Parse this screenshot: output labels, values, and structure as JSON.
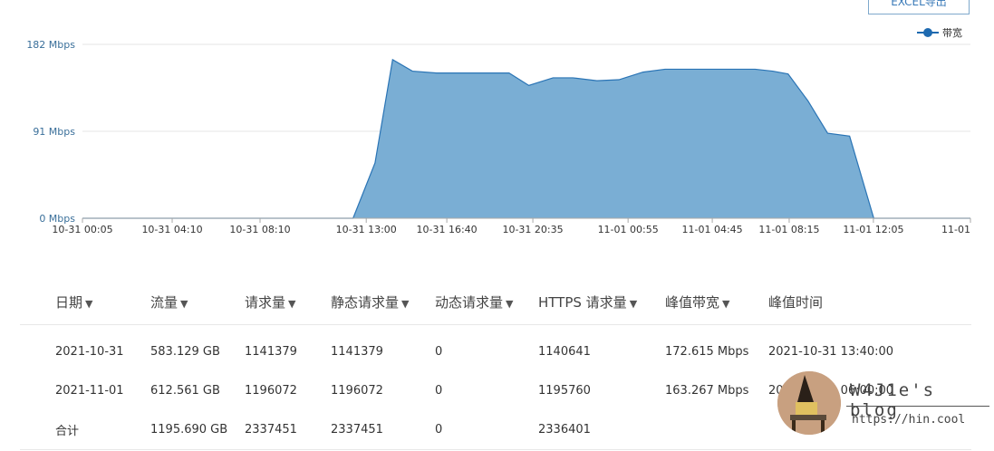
{
  "toolbar": {
    "export_label": "EXCEL导出"
  },
  "chart_data": {
    "type": "area",
    "legend": "带宽",
    "y_ticks": [
      "0 Mbps",
      "91 Mbps",
      "182 Mbps"
    ],
    "y_tick_values": [
      0,
      91,
      182
    ],
    "ylim": [
      0,
      182
    ],
    "x_tick_labels": [
      "10-31 00:05",
      "10-31 04:10",
      "10-31 08:10",
      "10-31 13:00",
      "10-31 16:40",
      "10-31 20:35",
      "11-01 00:55",
      "11-01 04:45",
      "11-01 08:15",
      "11-01 12:05",
      "11-01"
    ],
    "x_tick_hours": [
      0.083,
      4.167,
      8.167,
      13.0,
      16.667,
      20.583,
      24.917,
      28.75,
      32.25,
      36.083,
      40.5
    ],
    "xlim_hours": [
      0.083,
      40.5
    ],
    "series": [
      {
        "name": "带宽",
        "x_hours": [
          0.083,
          12.4,
          13.4,
          14.2,
          15.1,
          16.2,
          17.3,
          18.3,
          19.5,
          20.4,
          21.5,
          22.4,
          23.5,
          24.5,
          25.6,
          26.6,
          27.6,
          28.7,
          29.6,
          30.7,
          31.5,
          32.2,
          33.1,
          34.0,
          35.0,
          36.1,
          37.0,
          40.5
        ],
        "values": [
          0,
          0,
          58,
          166,
          154,
          152,
          152,
          152,
          152,
          139,
          147,
          147,
          144,
          145,
          153,
          156,
          156,
          156,
          156,
          156,
          154,
          151,
          123,
          89,
          86,
          0,
          0,
          0
        ]
      }
    ],
    "grid": true
  },
  "table": {
    "headers": [
      "日期",
      "流量",
      "请求量",
      "静态请求量",
      "动态请求量",
      "HTTPS 请求量",
      "峰值带宽",
      "峰值时间"
    ],
    "sortable": [
      true,
      true,
      true,
      true,
      true,
      true,
      true,
      false
    ],
    "rows": [
      [
        "2021-10-31",
        "583.129 GB",
        "1141379",
        "1141379",
        "0",
        "1140641",
        "172.615 Mbps",
        "2021-10-31 13:40:00"
      ],
      [
        "2021-11-01",
        "612.561 GB",
        "1196072",
        "1196072",
        "0",
        "1195760",
        "163.267 Mbps",
        "2021-11-01 06:00:00"
      ],
      [
        "合计",
        "1195.690 GB",
        "2337451",
        "2337451",
        "0",
        "2336401",
        "",
        ""
      ]
    ]
  },
  "watermark": {
    "title": "W4J1e's blog",
    "url": "https://hin.cool"
  }
}
